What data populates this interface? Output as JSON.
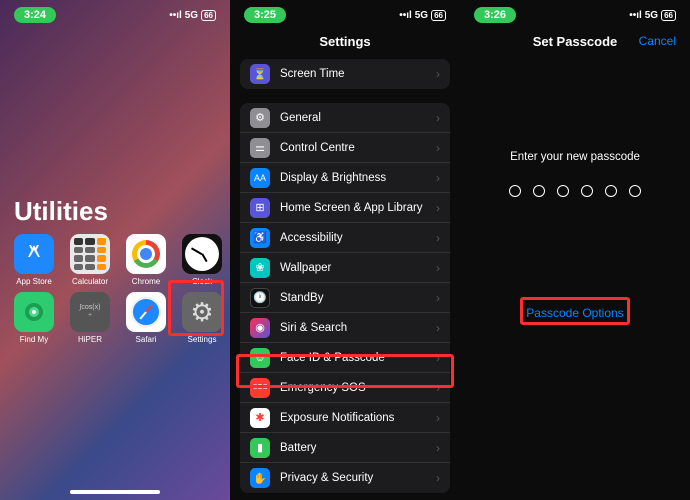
{
  "screen1": {
    "time": "3:24",
    "network": "5G",
    "battery": "66",
    "folder_title": "Utilities",
    "apps": [
      {
        "label": "App Store",
        "icon": "appstore"
      },
      {
        "label": "Calculator",
        "icon": "calc"
      },
      {
        "label": "Chrome",
        "icon": "chrome"
      },
      {
        "label": "Clock",
        "icon": "clock"
      },
      {
        "label": "Find My",
        "icon": "findmy"
      },
      {
        "label": "HiPER",
        "icon": "hiper"
      },
      {
        "label": "Safari",
        "icon": "safari"
      },
      {
        "label": "Settings",
        "icon": "settings"
      }
    ]
  },
  "screen2": {
    "time": "3:25",
    "network": "5G",
    "battery": "66",
    "title": "Settings",
    "group1": [
      {
        "label": "Screen Time",
        "icon": "screentime"
      }
    ],
    "group2": [
      {
        "label": "General",
        "icon": "general"
      },
      {
        "label": "Control Centre",
        "icon": "control"
      },
      {
        "label": "Display & Brightness",
        "icon": "display"
      },
      {
        "label": "Home Screen & App Library",
        "icon": "home"
      },
      {
        "label": "Accessibility",
        "icon": "access"
      },
      {
        "label": "Wallpaper",
        "icon": "wallpaper"
      },
      {
        "label": "StandBy",
        "icon": "standby"
      },
      {
        "label": "Siri & Search",
        "icon": "siri"
      },
      {
        "label": "Face ID & Passcode",
        "icon": "faceid"
      },
      {
        "label": "Emergency SOS",
        "icon": "sos"
      },
      {
        "label": "Exposure Notifications",
        "icon": "exposure"
      },
      {
        "label": "Battery",
        "icon": "battery"
      },
      {
        "label": "Privacy & Security",
        "icon": "privacy"
      }
    ]
  },
  "screen3": {
    "time": "3:26",
    "network": "5G",
    "battery": "66",
    "title": "Set Passcode",
    "cancel": "Cancel",
    "prompt": "Enter your new passcode",
    "options": "Passcode Options"
  }
}
